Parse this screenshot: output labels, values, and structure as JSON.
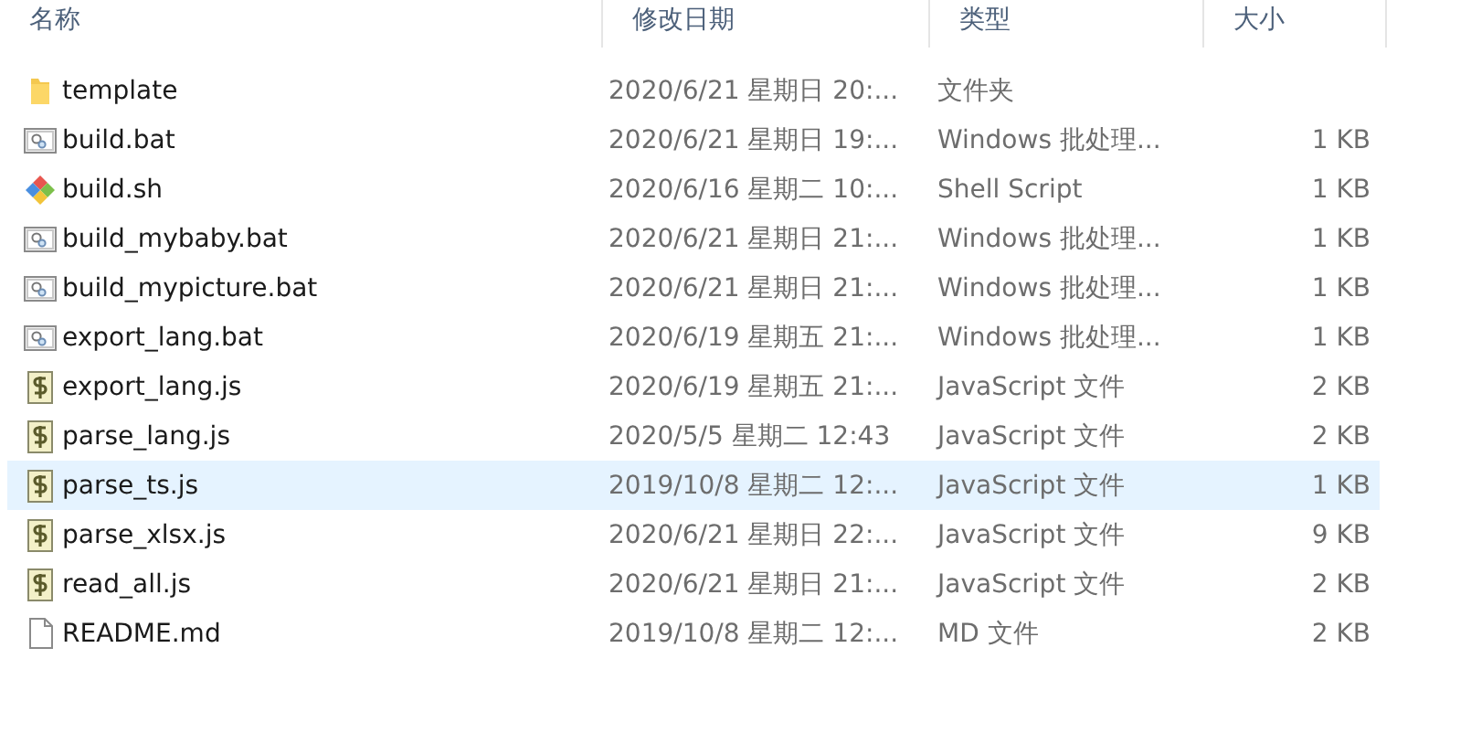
{
  "columns": [
    {
      "label": "名称"
    },
    {
      "label": "修改日期"
    },
    {
      "label": "类型"
    },
    {
      "label": "大小"
    }
  ],
  "rows": [
    {
      "kind": "folder",
      "name": "template",
      "date": "2020/6/21 星期日 20:...",
      "type": "文件夹",
      "selected": false
    },
    {
      "kind": "bat",
      "name": "build.bat",
      "date": "2020/6/21 星期日 19:...",
      "type": "Windows 批处理...",
      "size": "1 KB",
      "selected": false
    },
    {
      "kind": "sh",
      "name": "build.sh",
      "date": "2020/6/16 星期二 10:...",
      "type": "Shell Script",
      "size": "1 KB",
      "selected": false
    },
    {
      "kind": "bat",
      "name": "build_mybaby.bat",
      "date": "2020/6/21 星期日 21:...",
      "type": "Windows 批处理...",
      "size": "1 KB",
      "selected": false
    },
    {
      "kind": "bat",
      "name": "build_mypicture.bat",
      "date": "2020/6/21 星期日 21:...",
      "type": "Windows 批处理...",
      "size": "1 KB",
      "selected": false
    },
    {
      "kind": "bat",
      "name": "export_lang.bat",
      "date": "2020/6/19 星期五 21:...",
      "type": "Windows 批处理...",
      "size": "1 KB",
      "selected": false
    },
    {
      "kind": "js",
      "name": "export_lang.js",
      "date": "2020/6/19 星期五 21:...",
      "type": "JavaScript 文件",
      "size": "2 KB",
      "selected": false
    },
    {
      "kind": "js",
      "name": "parse_lang.js",
      "date": "2020/5/5 星期二 12:43",
      "type": "JavaScript 文件",
      "size": "2 KB",
      "selected": false
    },
    {
      "kind": "js",
      "name": "parse_ts.js",
      "date": "2019/10/8 星期二 12:...",
      "type": "JavaScript 文件",
      "size": "1 KB",
      "selected": true
    },
    {
      "kind": "js",
      "name": "parse_xlsx.js",
      "date": "2020/6/21 星期日 22:...",
      "type": "JavaScript 文件",
      "size": "9 KB",
      "selected": false
    },
    {
      "kind": "js",
      "name": "read_all.js",
      "date": "2020/6/21 星期日 21:...",
      "type": "JavaScript 文件",
      "size": "2 KB",
      "selected": false
    },
    {
      "kind": "md",
      "name": "README.md",
      "date": "2019/10/8 星期二 12:...",
      "type": "MD 文件",
      "size": "2 KB",
      "selected": false
    }
  ]
}
